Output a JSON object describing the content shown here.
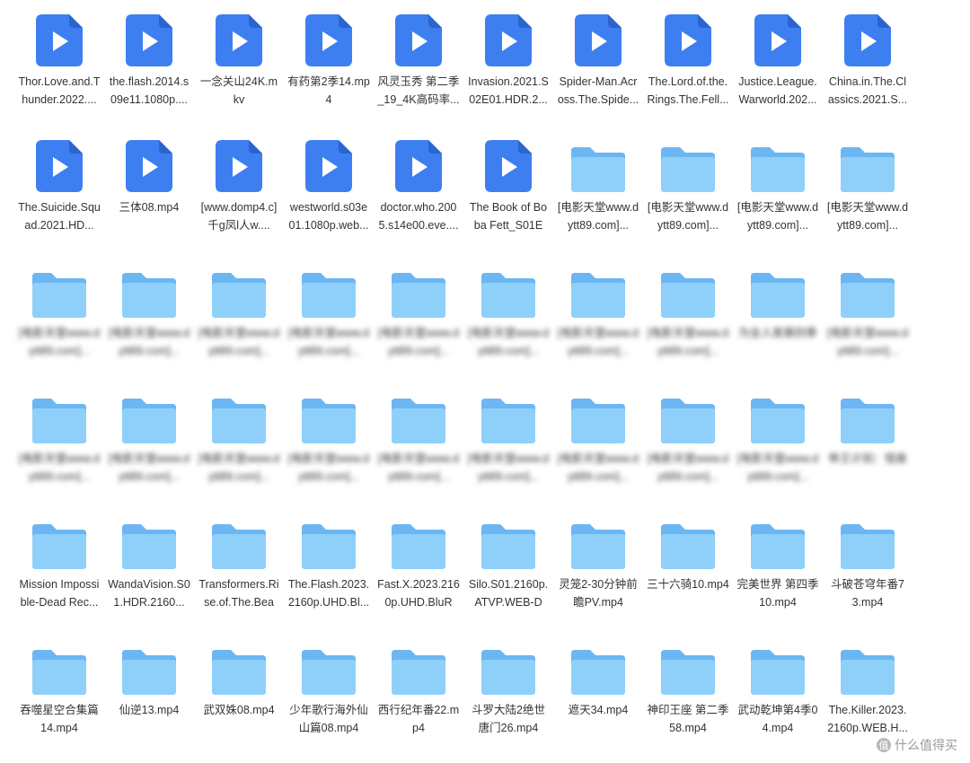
{
  "colors": {
    "video_icon": "#3d7ff0",
    "folder_back": "#6cb6f3",
    "folder_front": "#8fd0fb",
    "label_text": "#333333"
  },
  "icons": {
    "video": "video-file-icon",
    "folder": "folder-icon"
  },
  "items": [
    {
      "type": "video",
      "label": "Thor.Love.and.Thunder.2022...."
    },
    {
      "type": "video",
      "label": "the.flash.2014.s09e11.1080p...."
    },
    {
      "type": "video",
      "label": "一念关山24K.mkv"
    },
    {
      "type": "video",
      "label": "有药第2季14.mp4"
    },
    {
      "type": "video",
      "label": "风灵玉秀 第二季_19_4K高码率..."
    },
    {
      "type": "video",
      "label": "Invasion.2021.S02E01.HDR.2..."
    },
    {
      "type": "video",
      "label": "Spider-Man.Across.The.Spide..."
    },
    {
      "type": "video",
      "label": "The.Lord.of.the.Rings.The.Fell..."
    },
    {
      "type": "video",
      "label": "Justice.League.Warworld.202..."
    },
    {
      "type": "video",
      "label": "China.in.The.Classics.2021.S..."
    },
    {
      "type": "video",
      "label": "The.Suicide.Squad.2021.HD..."
    },
    {
      "type": "video",
      "label": "三体08.mp4"
    },
    {
      "type": "video",
      "label": "[www.domp4.c]千g凤l人w...."
    },
    {
      "type": "video",
      "label": "westworld.s03e01.1080p.web..."
    },
    {
      "type": "video",
      "label": "doctor.who.2005.s14e00.eve...."
    },
    {
      "type": "video",
      "label": "The Book of Boba Fett_S01E0..."
    },
    {
      "type": "folder",
      "label": "[电影天堂www.dytt89.com]..."
    },
    {
      "type": "folder",
      "label": "[电影天堂www.dytt89.com]..."
    },
    {
      "type": "folder",
      "label": "[电影天堂www.dytt89.com]..."
    },
    {
      "type": "folder",
      "label": "[电影天堂www.dytt89.com]..."
    },
    {
      "type": "folder",
      "label": "[电影天堂www.dytt89.com]...",
      "blur": true
    },
    {
      "type": "folder",
      "label": "[电影天堂www.dytt89.com]...",
      "blur": true
    },
    {
      "type": "folder",
      "label": "[电影天堂www.dytt89.com]...",
      "blur": true
    },
    {
      "type": "folder",
      "label": "[电影天堂www.dytt89.com]...",
      "blur": true
    },
    {
      "type": "folder",
      "label": "[电影天堂www.dytt89.com]...",
      "blur": true
    },
    {
      "type": "folder",
      "label": "[电影天堂www.dytt89.com]...",
      "blur": true
    },
    {
      "type": "folder",
      "label": "[电影天堂www.dytt89.com]...",
      "blur": true
    },
    {
      "type": "folder",
      "label": "[电影天堂www.dytt89.com]...",
      "blur": true
    },
    {
      "type": "folder",
      "label": "为全人类第四季",
      "blur": true
    },
    {
      "type": "folder",
      "label": "[电影天堂www.dytt89.com]...",
      "blur": true
    },
    {
      "type": "folder",
      "label": "[电影天堂www.dytt89.com]...",
      "blur": true
    },
    {
      "type": "folder",
      "label": "[电影天堂www.dytt89.com]...",
      "blur": true
    },
    {
      "type": "folder",
      "label": "[电影天堂www.dytt89.com]...",
      "blur": true
    },
    {
      "type": "folder",
      "label": "[电影天堂www.dytt89.com]...",
      "blur": true
    },
    {
      "type": "folder",
      "label": "[电影天堂www.dytt89.com]...",
      "blur": true
    },
    {
      "type": "folder",
      "label": "[电影天堂www.dytt89.com]...",
      "blur": true
    },
    {
      "type": "folder",
      "label": "[电影天堂www.dytt89.com]...",
      "blur": true
    },
    {
      "type": "folder",
      "label": "[电影天堂www.dytt89.com]...",
      "blur": true
    },
    {
      "type": "folder",
      "label": "[电影天堂www.dytt89.com]...",
      "blur": true
    },
    {
      "type": "folder",
      "label": "帝王计划：怪兽",
      "blur": true
    },
    {
      "type": "folder",
      "label": "Mission Impossible-Dead Rec..."
    },
    {
      "type": "folder",
      "label": "WandaVision.S01.HDR.2160..."
    },
    {
      "type": "folder",
      "label": "Transformers.Rise.of.The.Beas..."
    },
    {
      "type": "folder",
      "label": "The.Flash.2023.2160p.UHD.Bl..."
    },
    {
      "type": "folder",
      "label": "Fast.X.2023.2160p.UHD.BluRa..."
    },
    {
      "type": "folder",
      "label": "Silo.S01.2160p.ATVP.WEB-DL..."
    },
    {
      "type": "folder",
      "label": "灵笼2-30分钟前瞻PV.mp4"
    },
    {
      "type": "folder",
      "label": "三十六骑10.mp4"
    },
    {
      "type": "folder",
      "label": "完美世界 第四季10.mp4"
    },
    {
      "type": "folder",
      "label": "斗破苍穹年番73.mp4"
    },
    {
      "type": "folder",
      "label": "吞噬星空合集篇14.mp4"
    },
    {
      "type": "folder",
      "label": "仙逆13.mp4"
    },
    {
      "type": "folder",
      "label": "武双姝08.mp4"
    },
    {
      "type": "folder",
      "label": "少年歌行海外仙山篇08.mp4"
    },
    {
      "type": "folder",
      "label": "西行纪年番22.mp4"
    },
    {
      "type": "folder",
      "label": "斗罗大陆2绝世唐门26.mp4"
    },
    {
      "type": "folder",
      "label": "遮天34.mp4"
    },
    {
      "type": "folder",
      "label": "神印王座 第二季58.mp4"
    },
    {
      "type": "folder",
      "label": "武动乾坤第4季04.mp4"
    },
    {
      "type": "folder",
      "label": "The.Killer.2023.2160p.WEB.H..."
    }
  ],
  "watermark": {
    "logo_char": "值",
    "text": "什么值得买"
  }
}
